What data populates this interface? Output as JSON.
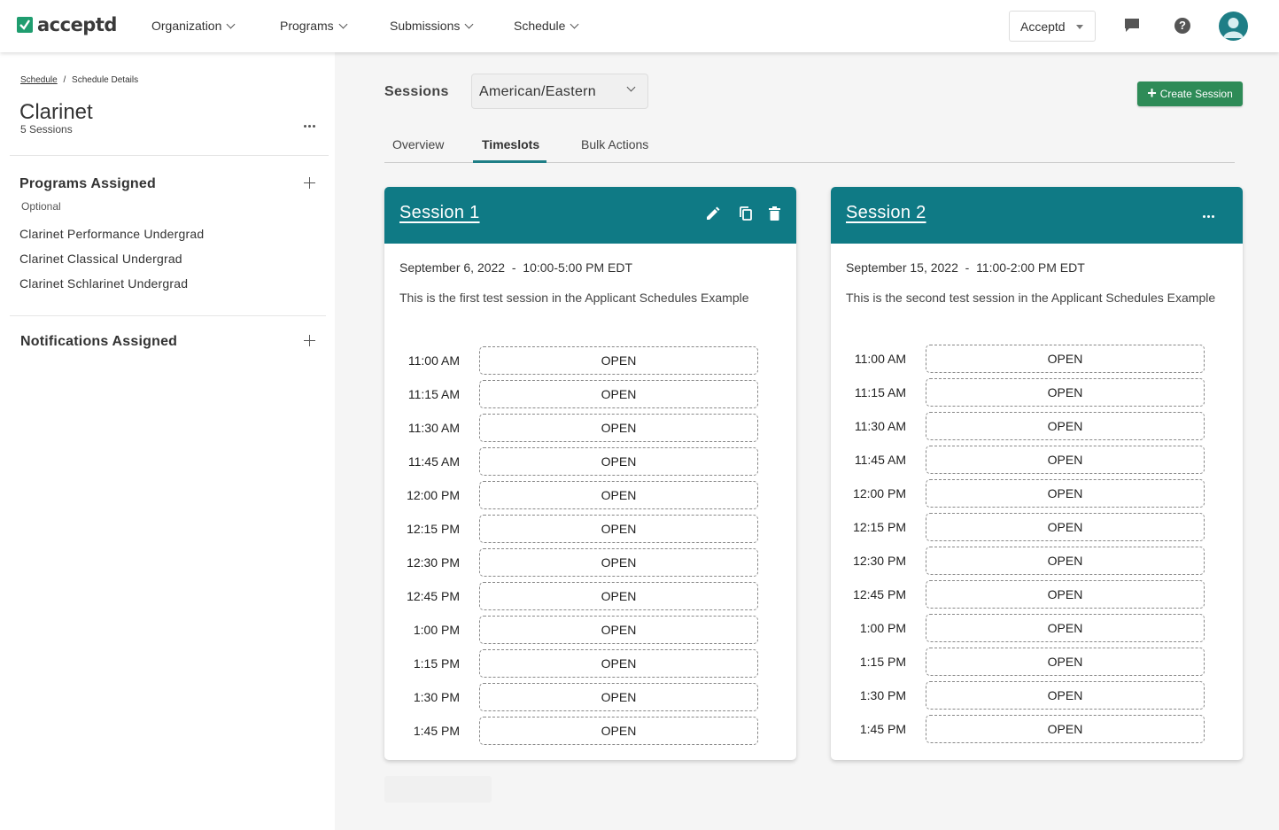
{
  "topnav": {
    "brand": "acceptd",
    "menu": [
      "Organization",
      "Programs",
      "Submissions",
      "Schedule"
    ],
    "org_select": "Acceptd"
  },
  "sidebar": {
    "breadcrumb_link": "Schedule",
    "breadcrumb_sep": "/",
    "breadcrumb_current": "Schedule Details",
    "title": "Clarinet",
    "subtitle": "5 Sessions",
    "programs_title": "Programs Assigned",
    "programs_optional": "Optional",
    "programs": [
      "Clarinet Performance Undergrad",
      "Clarinet Classical Undergrad",
      "Clarinet Schlarinet Undergrad"
    ],
    "notifications_title": "Notifications Assigned"
  },
  "main": {
    "sessions_label": "Sessions",
    "timezone": "American/Eastern",
    "create_button": "Create Session",
    "tabs": [
      "Overview",
      "Timeslots",
      "Bulk Actions"
    ],
    "active_tab": "Timeslots"
  },
  "sessions": [
    {
      "title": "Session 1",
      "date": "September 6, 2022  -  10:00-5:00 PM EDT",
      "description": "This is the first test session in the Applicant Schedules Example",
      "slots": [
        {
          "time": "11:00 AM",
          "status": "OPEN"
        },
        {
          "time": "11:15 AM",
          "status": "OPEN"
        },
        {
          "time": "11:30 AM",
          "status": "OPEN"
        },
        {
          "time": "11:45 AM",
          "status": "OPEN"
        },
        {
          "time": "12:00 PM",
          "status": "OPEN"
        },
        {
          "time": "12:15 PM",
          "status": "OPEN"
        },
        {
          "time": "12:30 PM",
          "status": "OPEN"
        },
        {
          "time": "12:45 PM",
          "status": "OPEN"
        },
        {
          "time": "1:00 PM",
          "status": "OPEN"
        },
        {
          "time": "1:15 PM",
          "status": "OPEN"
        },
        {
          "time": "1:30 PM",
          "status": "OPEN"
        },
        {
          "time": "1:45 PM",
          "status": "OPEN"
        }
      ]
    },
    {
      "title": "Session 2",
      "date": "September 15, 2022  -  11:00-2:00 PM EDT",
      "description": "This is the second test session in the Applicant Schedules Example",
      "slots": [
        {
          "time": "11:00 AM",
          "status": "OPEN"
        },
        {
          "time": "11:15 AM",
          "status": "OPEN"
        },
        {
          "time": "11:30 AM",
          "status": "OPEN"
        },
        {
          "time": "11:45 AM",
          "status": "OPEN"
        },
        {
          "time": "12:00 PM",
          "status": "OPEN"
        },
        {
          "time": "12:15 PM",
          "status": "OPEN"
        },
        {
          "time": "12:30 PM",
          "status": "OPEN"
        },
        {
          "time": "12:45 PM",
          "status": "OPEN"
        },
        {
          "time": "1:00 PM",
          "status": "OPEN"
        },
        {
          "time": "1:15 PM",
          "status": "OPEN"
        },
        {
          "time": "1:30 PM",
          "status": "OPEN"
        },
        {
          "time": "1:45 PM",
          "status": "OPEN"
        }
      ]
    }
  ],
  "colors": {
    "brand_green": "#1f9d6f",
    "teal_header": "#0f7a85",
    "create_button": "#2e8b57"
  }
}
